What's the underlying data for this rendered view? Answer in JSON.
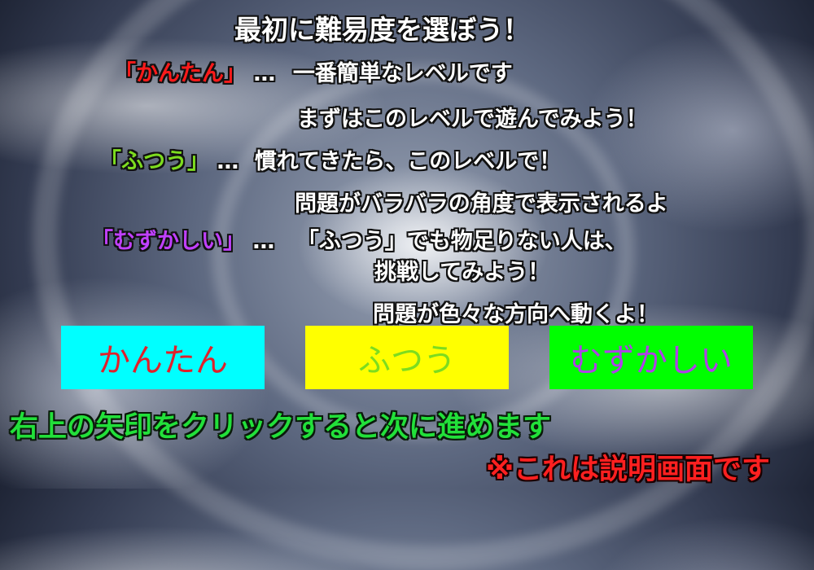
{
  "heading": "最初に難易度を選ぼう！",
  "easy_desc": {
    "label": "「かんたん」",
    "ellipsis": "…",
    "line1": "一番簡単なレベルです",
    "line2": "まずはこのレベルで遊んでみよう！",
    "label_color": "#ff1a1a"
  },
  "normal_desc": {
    "label": "「ふつう」",
    "ellipsis": "…",
    "line1": "慣れてきたら、このレベルで！",
    "line2": "問題がバラバラの角度で表示されるよ",
    "label_color": "#7ddc1f"
  },
  "hard_desc": {
    "label": "「むずかしい」",
    "ellipsis": "…",
    "line1": "「ふつう」でも物足りない人は、",
    "line2": "挑戦してみよう！",
    "line3": "問題が色々な方向へ動くよ！",
    "label_color": "#c040ff"
  },
  "buttons": {
    "easy": {
      "label": "かんたん",
      "bg": "#00ffff",
      "color": "#e0202a"
    },
    "normal": {
      "label": "ふつう",
      "bg": "#ffff00",
      "color": "#7ddc1f"
    },
    "hard": {
      "label": "むずかしい",
      "bg": "#00ff00",
      "color": "#b040e8"
    }
  },
  "footer": {
    "next_hint": "右上の矢印をクリックすると次に進めます",
    "note": "※これは説明画面です",
    "next_color": "#22e03a",
    "note_color": "#ff2020"
  }
}
